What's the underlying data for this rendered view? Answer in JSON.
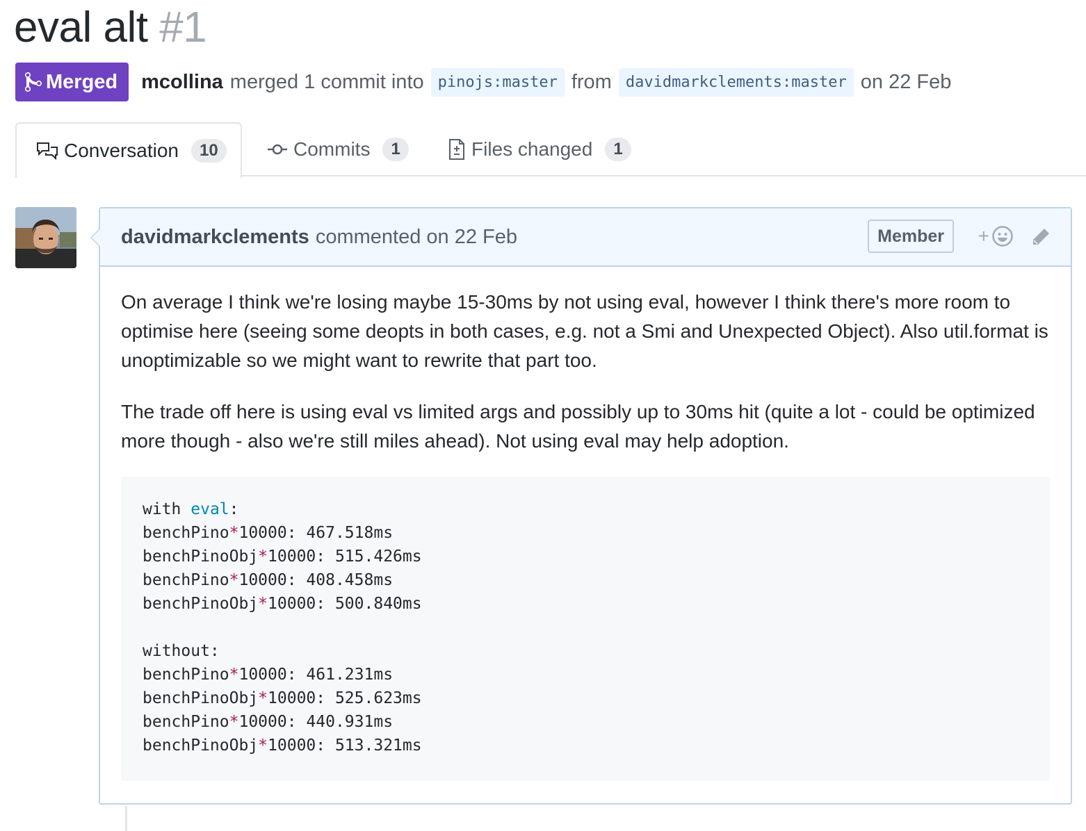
{
  "pr": {
    "title": "eval alt",
    "number": "#1",
    "state": "Merged",
    "author": "mcollina",
    "merged_text": "merged 1 commit into",
    "base_branch_owner": "pinojs",
    "base_branch_name": "master",
    "from_text": "from",
    "head_branch_owner": "davidmarkclements",
    "head_branch_name": "master",
    "date_text": "on 22 Feb"
  },
  "tabs": [
    {
      "label": "Conversation",
      "count": "10",
      "icon": "comment-discussion-icon",
      "selected": true
    },
    {
      "label": "Commits",
      "count": "1",
      "icon": "git-commit-icon",
      "selected": false
    },
    {
      "label": "Files changed",
      "count": "1",
      "icon": "diff-icon",
      "selected": false
    }
  ],
  "comment": {
    "author": "davidmarkclements",
    "timestamp": "commented on 22 Feb",
    "role_badge": "Member",
    "reaction_plus": "+",
    "paragraphs": [
      "On average I think we're losing maybe 15-30ms by not using eval, however I think there's more room to optimise here (seeing some deopts in both cases, e.g. not a Smi and Unexpected Object). Also util.format is unoptimizable so we might want to rewrite that part too.",
      "The trade off here is using eval vs limited args and possibly up to 30ms hit (quite a lot - could be optimized more though - also we're still miles ahead). Not using eval may help adoption."
    ],
    "code": {
      "section1_prefix": "with ",
      "section1_keyword": "eval",
      "section1_suffix": ":",
      "section1_lines": [
        {
          "name": "benchPino",
          "op": "*",
          "rest": "10000: 467.518ms"
        },
        {
          "name": "benchPinoObj",
          "op": "*",
          "rest": "10000: 515.426ms"
        },
        {
          "name": "benchPino",
          "op": "*",
          "rest": "10000: 408.458ms"
        },
        {
          "name": "benchPinoObj",
          "op": "*",
          "rest": "10000: 500.840ms"
        }
      ],
      "section2_header": "without:",
      "section2_lines": [
        {
          "name": "benchPino",
          "op": "*",
          "rest": "10000: 461.231ms"
        },
        {
          "name": "benchPinoObj",
          "op": "*",
          "rest": "10000: 525.623ms"
        },
        {
          "name": "benchPino",
          "op": "*",
          "rest": "10000: 440.931ms"
        },
        {
          "name": "benchPinoObj",
          "op": "*",
          "rest": "10000: 513.321ms"
        }
      ]
    }
  },
  "colors": {
    "merged_purple": "#6f42c1",
    "comment_header_bg": "#f1f8ff",
    "comment_border": "#c0d3eb",
    "branch_bg": "#eaf5ff",
    "code_keyword": "#0086b3",
    "code_operator": "#a71d5d"
  }
}
